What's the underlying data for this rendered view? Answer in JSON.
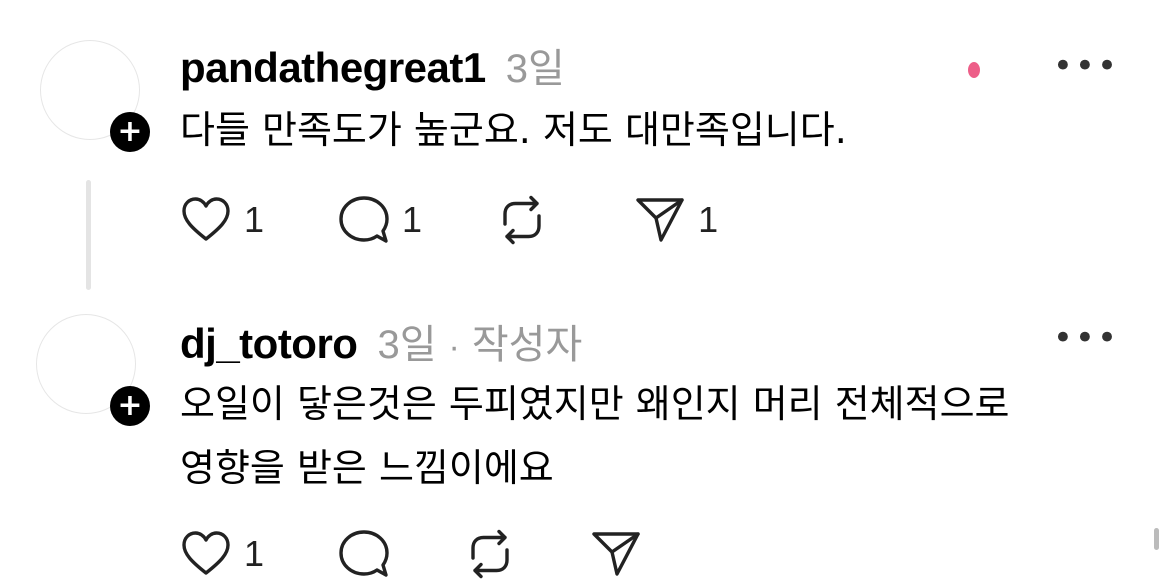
{
  "posts": [
    {
      "username": "pandathegreat1",
      "time": "3일",
      "body": "다들 만족도가 높군요. 저도 대만족입니다.",
      "actions": {
        "likes": "1",
        "comments": "1",
        "reposts": "",
        "shares": "1"
      },
      "more": "•••"
    },
    {
      "username": "dj_totoro",
      "time": "3일",
      "separator": "·",
      "author_tag": "작성자",
      "body_lines": [
        "오일이 닿은것은 두피였지만 왜인지 머리 전체적으로",
        "영향을 받은 느낌이에요"
      ],
      "actions": {
        "likes": "1"
      },
      "more": "•••"
    }
  ],
  "icons": {
    "follow": "plus-icon",
    "like": "heart-icon",
    "comment": "comment-bubble-icon",
    "repost": "repost-icon",
    "share": "send-icon"
  },
  "follow_badge": "+",
  "colors": {
    "text": "#000000",
    "muted": "#999999",
    "accent": "#e8366a"
  }
}
